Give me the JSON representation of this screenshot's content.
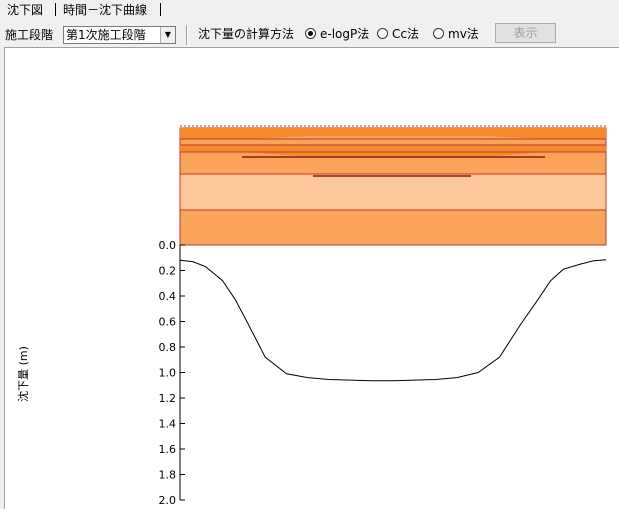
{
  "tabs": [
    {
      "label": "沈下図"
    },
    {
      "label": "時間－沈下曲線"
    }
  ],
  "toolbar": {
    "stage_label": "施工段階",
    "stage_value": "第1次施工段階",
    "method_label": "沈下量の計算方法",
    "methods": [
      {
        "label": "e-logP法",
        "checked": true
      },
      {
        "label": "Cc法",
        "checked": false
      },
      {
        "label": "mv法",
        "checked": false
      }
    ],
    "display_button": "表示"
  },
  "chart_data": {
    "type": "line",
    "ylabel": "沈下量 (m)",
    "ylim": [
      0.0,
      2.0
    ],
    "y_inverted": true,
    "y_ticks": [
      "0.0",
      "0.2",
      "0.4",
      "0.6",
      "0.8",
      "1.0",
      "1.2",
      "1.4",
      "1.6",
      "1.8",
      "2.0"
    ],
    "x": [
      0,
      0.03,
      0.06,
      0.1,
      0.13,
      0.16,
      0.2,
      0.25,
      0.3,
      0.35,
      0.4,
      0.45,
      0.5,
      0.55,
      0.6,
      0.65,
      0.7,
      0.75,
      0.8,
      0.84,
      0.87,
      0.9,
      0.94,
      0.97,
      1.0
    ],
    "series": [
      {
        "values": [
          0.12,
          0.13,
          0.17,
          0.28,
          0.43,
          0.62,
          0.88,
          1.01,
          1.04,
          1.055,
          1.06,
          1.065,
          1.065,
          1.06,
          1.055,
          1.04,
          1.0,
          0.88,
          0.62,
          0.43,
          0.28,
          0.19,
          0.15,
          0.125,
          0.115
        ]
      }
    ],
    "colors": {
      "layer_dark": "#f48a2c",
      "layer_mid": "#f9a35b",
      "layer_light": "#fdc99a",
      "layer_border": "#c0392b",
      "curve": "#000000"
    }
  }
}
